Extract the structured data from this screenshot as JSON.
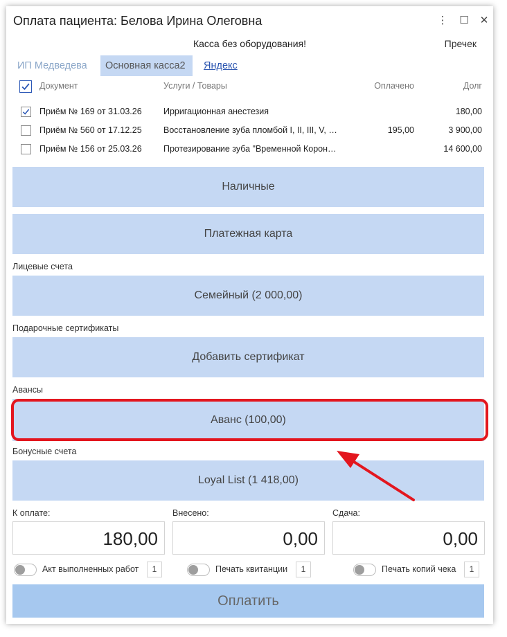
{
  "window": {
    "title": "Оплата пациента: Белова Ирина Олеговна",
    "controls": {
      "menu": "⋮",
      "maximize": "☐",
      "close": "✕"
    }
  },
  "kassa": {
    "status": "Касса без оборудования!",
    "recheck_label": "Пречек"
  },
  "tabs": [
    {
      "label": "ИП Медведева"
    },
    {
      "label": "Основная касса2"
    },
    {
      "label": "Яндекс"
    }
  ],
  "table": {
    "headers": {
      "document": "Документ",
      "services": "Услуги / Товары",
      "paid": "Оплачено",
      "debt": "Долг"
    },
    "rows": [
      {
        "document": "Приём № 169 от 31.03.26",
        "services": "Ирригационная анестезия",
        "paid": "",
        "debt": "180,00",
        "checked": true
      },
      {
        "document": "Приём № 560 от 17.12.25",
        "services": "Восстановление зуба пломбой I, II, III, V, …",
        "paid": "195,00",
        "debt": "3 900,00",
        "checked": false
      },
      {
        "document": "Приём № 156 от 25.03.26",
        "services": "Протезирование зуба \"Временной Корон…",
        "paid": "",
        "debt": "14 600,00",
        "checked": false
      }
    ]
  },
  "payment_methods": {
    "cash": "Наличные",
    "card": "Платежная карта",
    "accounts_label": "Лицевые счета",
    "family": "Семейный (2 000,00)",
    "certificates_label": "Подарочные сертификаты",
    "add_certificate": "Добавить сертификат",
    "advances_label": "Авансы",
    "advance": "Аванс (100,00)",
    "bonus_label": "Бонусные счета",
    "loyal": "Loyal List (1 418,00)"
  },
  "summary": {
    "to_pay_label": "К оплате:",
    "to_pay": "180,00",
    "deposited_label": "Внесено:",
    "deposited": "0,00",
    "change_label": "Сдача:",
    "change": "0,00"
  },
  "options": [
    {
      "label": "Акт выполненных работ",
      "copies": "1"
    },
    {
      "label": "Печать квитанции",
      "copies": "1"
    },
    {
      "label": "Печать копий чека",
      "copies": "1"
    }
  ],
  "pay_button": "Оплатить",
  "colors": {
    "button_bg": "#c5d8f3",
    "pay_bg": "#a6c8ef",
    "highlight": "#e3161e",
    "link": "#2b55b0"
  }
}
